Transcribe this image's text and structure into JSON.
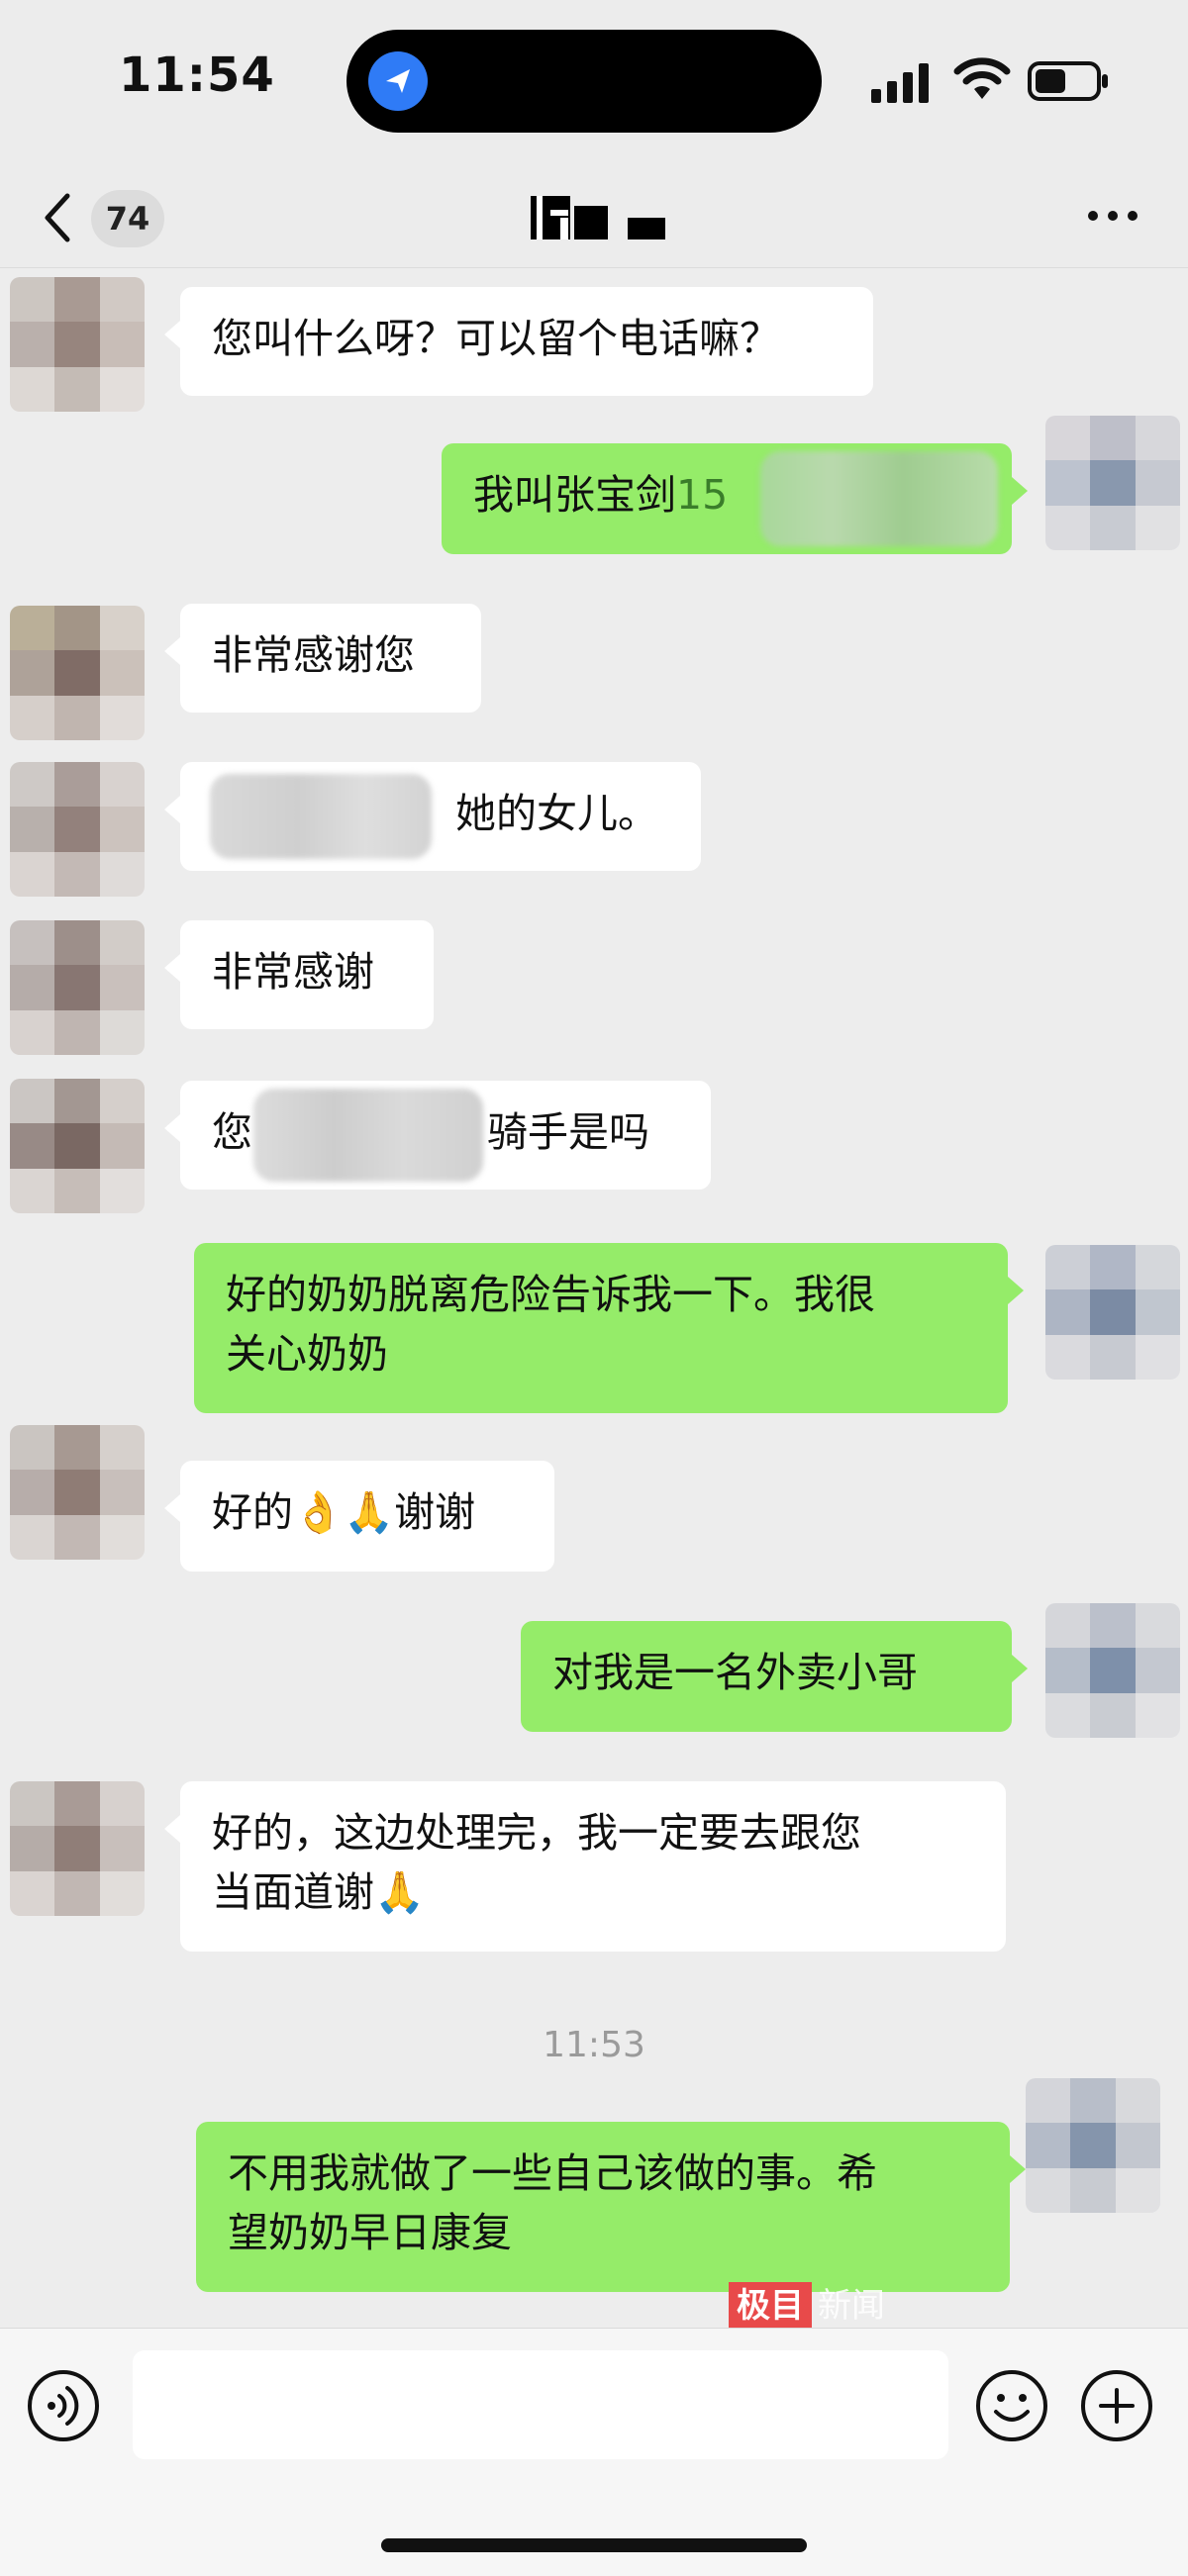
{
  "status_bar": {
    "time": "11:54"
  },
  "nav": {
    "unread_count": "74"
  },
  "messages": [
    {
      "side": "in",
      "text": "您叫什么呀？可以留个电话嘛？"
    },
    {
      "side": "out",
      "text": "我叫张宝剑",
      "suffix": "15"
    },
    {
      "side": "in",
      "text": "非常感谢您"
    },
    {
      "side": "in",
      "text": "她的女儿。"
    },
    {
      "side": "in",
      "text": "非常感谢"
    },
    {
      "side": "in",
      "text_start": "您",
      "text_end": "骑手是吗"
    },
    {
      "side": "out",
      "line1": "好的奶奶脱离危险告诉我一下。我很",
      "line2": "关心奶奶"
    },
    {
      "side": "in",
      "text": "好的👌🙏谢谢"
    },
    {
      "side": "out",
      "text": "对我是一名外卖小哥"
    },
    {
      "side": "in",
      "line1": "好的，这边处理完，我一定要去跟您",
      "line2": "当面道谢🙏"
    },
    {
      "side": "out",
      "line1": "不用我就做了一些自己该做的事。希",
      "line2": "望奶奶早日康复"
    }
  ],
  "timestamp": "11:53",
  "watermark": {
    "box": "极目",
    "text": "新闻"
  },
  "colors": {
    "outgoing_bubble": "#95ec69",
    "incoming_bubble": "#ffffff",
    "background": "#ededed"
  },
  "icons": [
    "back-chevron-icon",
    "more-icon",
    "voice-icon",
    "emoji-icon",
    "add-icon"
  ]
}
